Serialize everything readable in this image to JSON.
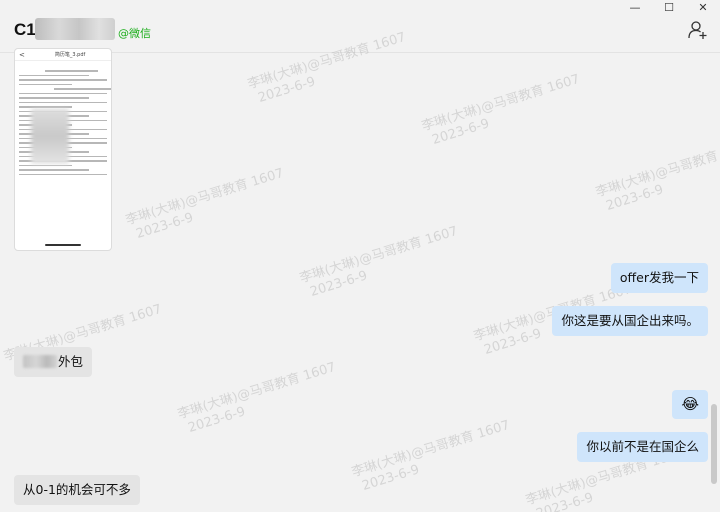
{
  "window": {
    "minimize_glyph": "—",
    "maximize_glyph": "☐",
    "close_glyph": "✕"
  },
  "header": {
    "contact_name_visible": "C1",
    "contact_tag": "@微信",
    "add_member_icon": "add-member-icon"
  },
  "watermark": {
    "line1": "李琳(大琳)@马哥教育 1607",
    "line2": "2023-6-9"
  },
  "file_preview": {
    "filename": "简历笔_3.pdf",
    "back_glyph": "<"
  },
  "messages": [
    {
      "side": "out",
      "text": "offer发我一下"
    },
    {
      "side": "out",
      "text": "你这是要从国企出来吗。"
    },
    {
      "side": "in",
      "text": "外包"
    },
    {
      "side": "out",
      "text": "😂"
    },
    {
      "side": "out",
      "text": "你以前不是在国企么"
    },
    {
      "side": "in",
      "text": "从0-1的机会可不多"
    }
  ],
  "colors": {
    "background": "#f2f2f2",
    "incoming_bubble": "#e4e4e4",
    "outgoing_bubble": "#cfe5fb",
    "wechat_green": "#1aad19"
  }
}
